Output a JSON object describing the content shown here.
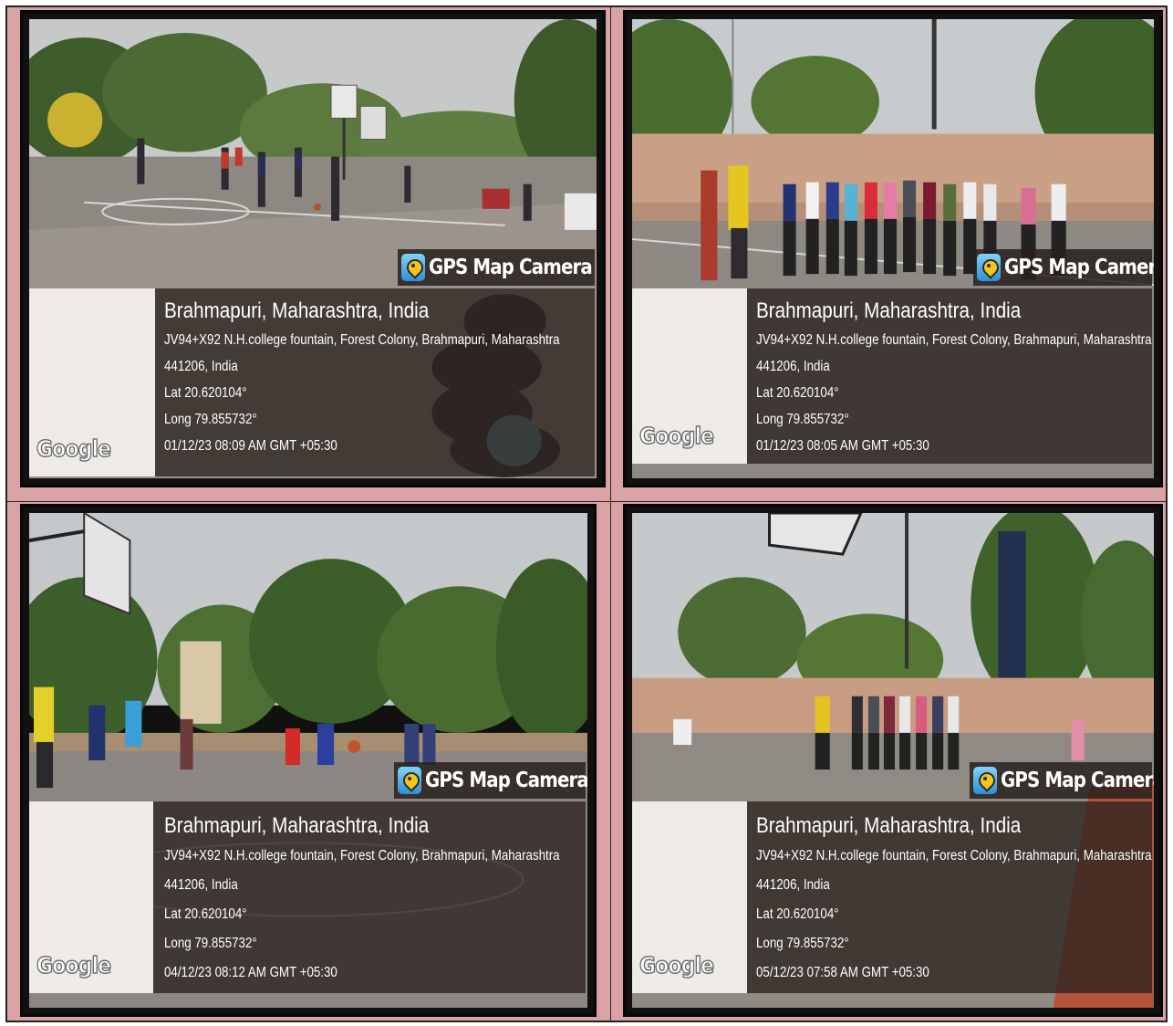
{
  "photos": [
    {
      "badge": "GPS Map Camera",
      "location_title": "Brahmapuri, Maharashtra, India",
      "address_line1": "JV94+X92 N.H.college fountain, Forest Colony, Brahmapuri, Maharashtra",
      "address_line2": "441206, India",
      "lat": "Lat 20.620104°",
      "long": "Long 79.855732°",
      "timestamp": "01/12/23 08:09 AM GMT +05:30",
      "map_logo": "Google"
    },
    {
      "badge": "GPS Map Camera",
      "location_title": "Brahmapuri, Maharashtra, India",
      "address_line1": "JV94+X92 N.H.college fountain, Forest Colony, Brahmapuri, Maharashtra",
      "address_line2": "441206, India",
      "lat": "Lat 20.620104°",
      "long": "Long 79.855732°",
      "timestamp": "01/12/23 08:05 AM GMT +05:30",
      "map_logo": "Google"
    },
    {
      "badge": "GPS Map Camera",
      "location_title": "Brahmapuri, Maharashtra, India",
      "address_line1": "JV94+X92 N.H.college fountain, Forest Colony, Brahmapuri, Maharashtra",
      "address_line2": "441206, India",
      "lat": "Lat 20.620104°",
      "long": "Long 79.855732°",
      "timestamp": "04/12/23 08:12 AM GMT +05:30",
      "map_logo": "Google"
    },
    {
      "badge": "GPS Map Camera",
      "location_title": "Brahmapuri, Maharashtra, India",
      "address_line1": "JV94+X92 N.H.college fountain, Forest Colony, Brahmapuri, Maharashtra",
      "address_line2": "441206, India",
      "lat": "Lat 20.620104°",
      "long": "Long 79.855732°",
      "timestamp": "05/12/23 07:58 AM GMT +05:30",
      "map_logo": "Google"
    }
  ],
  "colors": {
    "page_background": "#d9a3a5",
    "overlay": "#2d2420",
    "sky": "#c9cdd0",
    "court": "#8f8a84"
  }
}
